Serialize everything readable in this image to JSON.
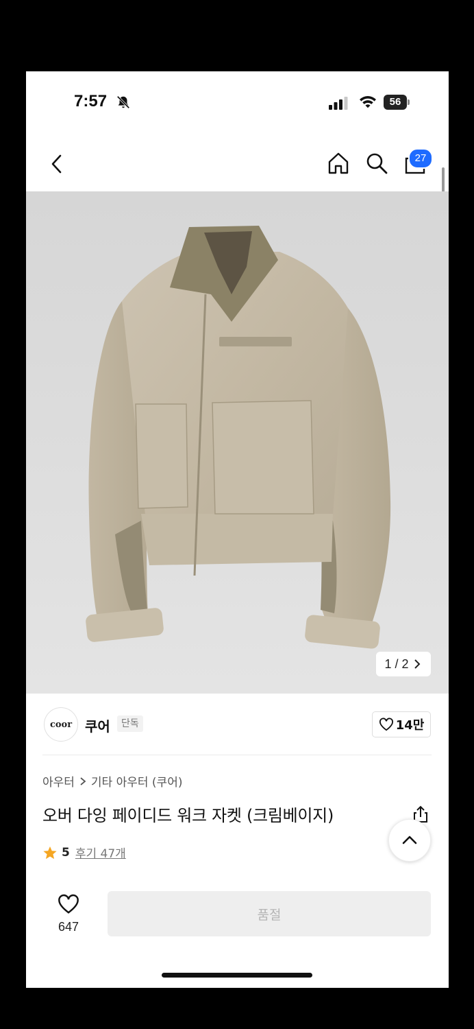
{
  "status_bar": {
    "time": "7:57",
    "battery": "56"
  },
  "header": {
    "cart_count": "27"
  },
  "product_image": {
    "counter": "1 / 2"
  },
  "brand": {
    "logo_text": "coor",
    "name": "쿠어",
    "tag": "단독",
    "likes": "14만"
  },
  "breadcrumb": {
    "items": [
      "아우터",
      "기타 아우터 (쿠어)"
    ]
  },
  "product": {
    "title": "오버 다잉 페이디드 워크 자켓 (크림베이지)",
    "rating": "5",
    "review_label": "후기 47개"
  },
  "bottom_bar": {
    "wish_count": "647",
    "buy_label": "품절"
  },
  "colors": {
    "accent": "#1e6bff",
    "star": "#f5a623",
    "disabled_bg": "#eeeeee",
    "disabled_text": "#b5b5b5"
  },
  "icons": [
    "bell-slash-icon",
    "signal-icon",
    "wifi-icon",
    "battery-icon",
    "back-icon",
    "home-icon",
    "search-icon",
    "shopping-bag-icon",
    "chevron-right-icon",
    "heart-icon",
    "share-icon",
    "chevron-up-icon",
    "star-icon"
  ]
}
